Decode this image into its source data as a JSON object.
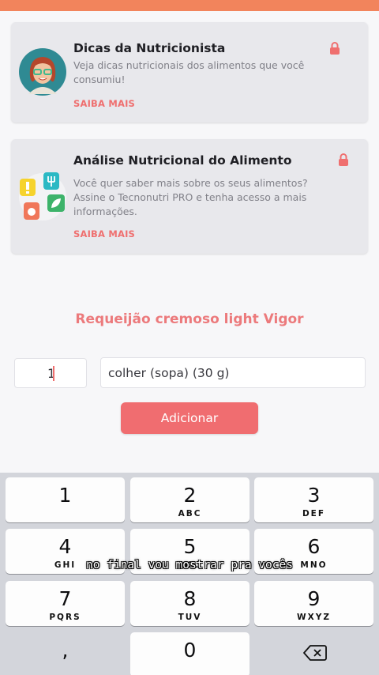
{
  "colors": {
    "accent": "#f06d70",
    "top_bar": "#f2845c",
    "card_bg": "#e8e8ec",
    "keyboard_bg": "#d3d5db"
  },
  "cards": [
    {
      "title": "Dicas da Nutricionista",
      "description": "Veja dicas nutricionais dos alimentos que você consumiu!",
      "link": "SAIBA MAIS",
      "icon": "nutritionist-avatar",
      "locked": true
    },
    {
      "title": "Análise Nutricional do Alimento",
      "description": "Você quer saber mais sobre os seus alimentos? Assine o Tecnonutri PRO e tenha acesso a mais informações.",
      "link": "SAIBA MAIS",
      "icon": "food-analysis-icons",
      "locked": true
    }
  ],
  "product": {
    "name": "Requeijão cremoso light Vigor",
    "quantity": "1",
    "unit": "colher (sopa) (30 g)",
    "add_label": "Adicionar"
  },
  "keyboard": {
    "keys": [
      {
        "num": "1",
        "letters": ""
      },
      {
        "num": "2",
        "letters": "ABC"
      },
      {
        "num": "3",
        "letters": "DEF"
      },
      {
        "num": "4",
        "letters": "GHI"
      },
      {
        "num": "5",
        "letters": "JKL"
      },
      {
        "num": "6",
        "letters": "MNO"
      },
      {
        "num": "7",
        "letters": "PQRS"
      },
      {
        "num": "8",
        "letters": "TUV"
      },
      {
        "num": "9",
        "letters": "WXYZ"
      },
      {
        "num": ",",
        "letters": ""
      },
      {
        "num": "0",
        "letters": ""
      }
    ],
    "delete_icon": "backspace-icon"
  },
  "caption": "no final vou mostrar pra vocês"
}
